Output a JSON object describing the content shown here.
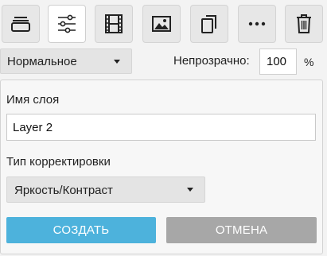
{
  "toolbar": {
    "buttons": [
      {
        "icon": "layer-stack-icon",
        "active": false
      },
      {
        "icon": "sliders-icon",
        "active": true
      },
      {
        "icon": "film-icon",
        "active": false
      },
      {
        "icon": "image-icon",
        "active": false
      },
      {
        "icon": "duplicate-icon",
        "active": false
      },
      {
        "icon": "more-icon",
        "active": false
      },
      {
        "icon": "trash-icon",
        "active": false
      }
    ]
  },
  "blend_mode": {
    "selected": "Нормальное"
  },
  "opacity": {
    "label": "Непрозрачно:",
    "value": "100",
    "unit": "%"
  },
  "form": {
    "name_label": "Имя слоя",
    "name_value": "Layer 2",
    "adjustment_label": "Тип корректировки",
    "adjustment_selected": "Яркость/Контраст",
    "create_label": "СОЗДАТЬ",
    "cancel_label": "ОТМЕНА"
  },
  "colors": {
    "primary": "#4db2dc",
    "secondary": "#a7a7a7",
    "background": "#f3f3f3"
  }
}
